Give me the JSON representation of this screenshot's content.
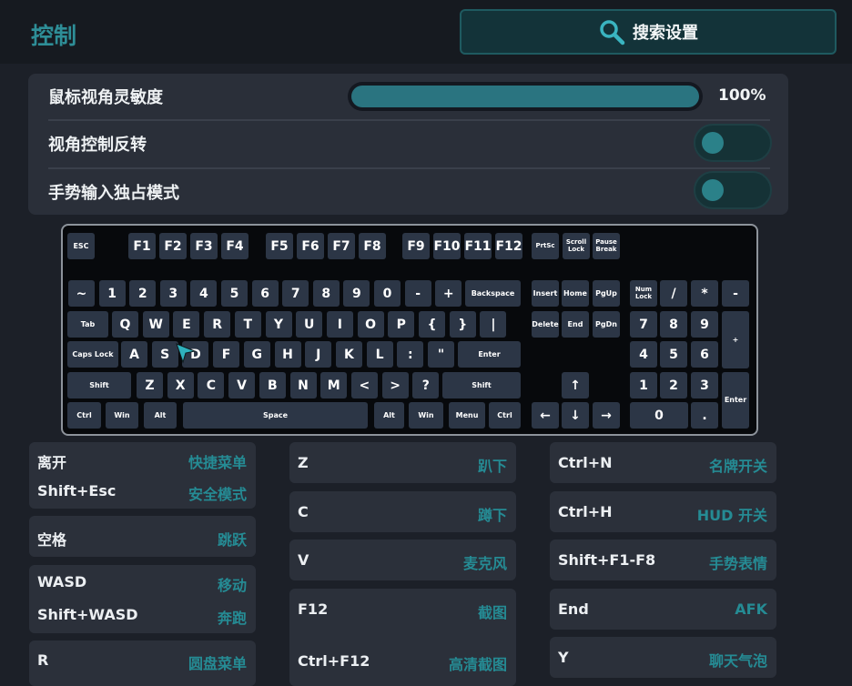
{
  "header": {
    "title": "控制",
    "search_label": "搜索设置"
  },
  "settings": {
    "sensitivity": {
      "label": "鼠标视角灵敏度",
      "value_text": "100%",
      "fraction": 1.0
    },
    "invert": {
      "label": "视角控制反转",
      "on": false
    },
    "gesture": {
      "label": "手势输入独占模式",
      "on": false
    }
  },
  "keyboard": {
    "fn_row": [
      "ESC",
      "F1",
      "F2",
      "F3",
      "F4",
      "F5",
      "F6",
      "F7",
      "F8",
      "F9",
      "F10",
      "F11",
      "F12",
      "PrtSc",
      "Scroll\nLock",
      "Pause\nBreak"
    ],
    "row1": [
      "~",
      "1",
      "2",
      "3",
      "4",
      "5",
      "6",
      "7",
      "8",
      "9",
      "0",
      "-",
      "+",
      "Backspace"
    ],
    "row2": [
      "Tab",
      "Q",
      "W",
      "E",
      "R",
      "T",
      "Y",
      "U",
      "I",
      "O",
      "P",
      "{",
      "}",
      "|"
    ],
    "row3": [
      "Caps Lock",
      "A",
      "S",
      "D",
      "F",
      "G",
      "H",
      "J",
      "K",
      "L",
      ":",
      "\"",
      "Enter"
    ],
    "row4": [
      "Shift",
      "Z",
      "X",
      "C",
      "V",
      "B",
      "N",
      "M",
      "<",
      ">",
      "?",
      "Shift"
    ],
    "row5": [
      "Ctrl",
      "Win",
      "Alt",
      "Space",
      "Alt",
      "Win",
      "Menu",
      "Ctrl"
    ],
    "nav": [
      "Insert",
      "Home",
      "PgUp",
      "Delete",
      "End",
      "PgDn"
    ],
    "arrows": [
      "↑",
      "←",
      "↓",
      "→"
    ],
    "numpad": [
      "Num\nLock",
      "/",
      "*",
      "-",
      "7",
      "8",
      "9",
      "+",
      "4",
      "5",
      "6",
      "1",
      "2",
      "3",
      "Enter",
      "0",
      "."
    ]
  },
  "bindings": {
    "col1": [
      {
        "rows": [
          {
            "key": "离开",
            "action": "快捷菜单"
          },
          {
            "key": "Shift+Esc",
            "action": "安全模式"
          }
        ]
      },
      {
        "rows": [
          {
            "key": "空格",
            "action": "跳跃"
          }
        ]
      },
      {
        "rows": [
          {
            "key": "WASD",
            "action": "移动"
          },
          {
            "key": "Shift+WASD",
            "action": "奔跑"
          }
        ]
      },
      {
        "rows": [
          {
            "key": "R",
            "action": "圆盘菜单"
          }
        ]
      }
    ],
    "col2": [
      {
        "rows": [
          {
            "key": "Z",
            "action": "趴下"
          }
        ]
      },
      {
        "rows": [
          {
            "key": "C",
            "action": "蹲下"
          }
        ]
      },
      {
        "rows": [
          {
            "key": "V",
            "action": "麦克风"
          }
        ]
      },
      {
        "rows": [
          {
            "key": "F12",
            "action": "截图"
          },
          {
            "key": "Ctrl+F12",
            "action": "高清截图"
          }
        ]
      }
    ],
    "col3": [
      {
        "rows": [
          {
            "key": "Ctrl+N",
            "action": "名牌开关"
          }
        ]
      },
      {
        "rows": [
          {
            "key": "Ctrl+H",
            "action": "HUD 开关"
          }
        ]
      },
      {
        "rows": [
          {
            "key": "Shift+F1-F8",
            "action": "手势表情"
          }
        ]
      },
      {
        "rows": [
          {
            "key": "End",
            "action": "AFK"
          }
        ]
      },
      {
        "rows": [
          {
            "key": "Y",
            "action": "聊天气泡"
          }
        ]
      }
    ]
  },
  "colors": {
    "accent": "#2e8e97",
    "panel": "#2a2f39",
    "key": "#2c3646",
    "background": "#1c2028"
  },
  "icons": {
    "search": "search-icon",
    "cursor": "cursor-icon"
  }
}
